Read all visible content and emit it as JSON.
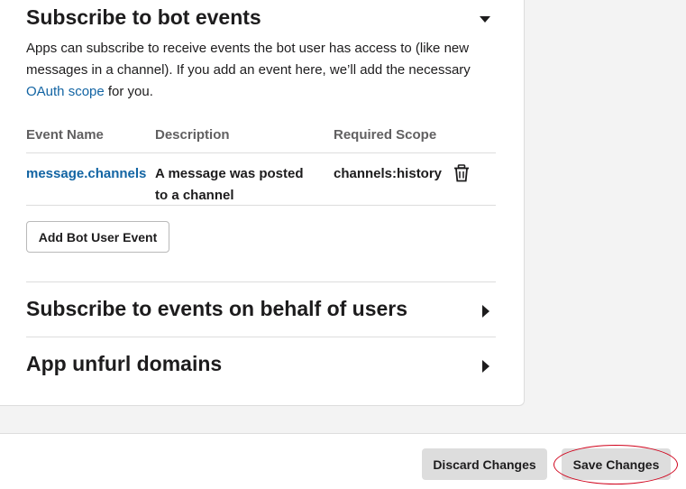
{
  "bot_events": {
    "title": "Subscribe to bot events",
    "description_before": "Apps can subscribe to receive events the bot user has access to (like new messages in a channel). If you add an event here, we’ll add the necessary ",
    "description_link": "OAuth scope",
    "description_after": " for you.",
    "columns": {
      "event_name": "Event Name",
      "description": "Description",
      "required_scope": "Required Scope"
    },
    "rows": [
      {
        "event_name": "message.channels",
        "description": "A message was posted to a channel",
        "required_scope": "channels:history"
      }
    ],
    "add_button": "Add Bot User Event",
    "toggle_icon": "caret-down-icon"
  },
  "user_events": {
    "title": "Subscribe to events on behalf of users",
    "toggle_icon": "caret-right-icon"
  },
  "unfurl_domains": {
    "title": "App unfurl domains",
    "toggle_icon": "caret-right-icon"
  },
  "footer": {
    "discard_label": "Discard Changes",
    "save_label": "Save Changes"
  },
  "colors": {
    "link": "#1264a3",
    "annotation": "#d0021b",
    "button_grey": "#dddddd"
  }
}
